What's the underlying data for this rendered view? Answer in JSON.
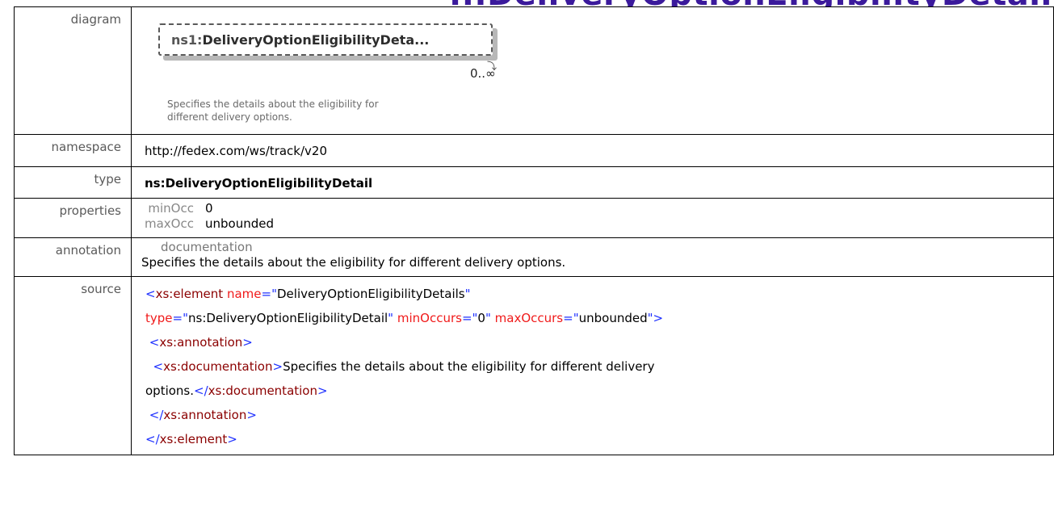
{
  "title_fragment": "...DeliveryOptionEligibilityDetails",
  "labels": {
    "diagram": "diagram",
    "namespace": "namespace",
    "type": "type",
    "properties": "properties",
    "annotation": "annotation",
    "source": "source"
  },
  "diagram": {
    "prefix": "ns1:",
    "name": "DeliveryOptionEligibilityDeta...",
    "cardinality": "0..∞",
    "documentation_line1": "Specifies the details about the eligibility for",
    "documentation_line2": "different delivery options."
  },
  "namespace": "http://fedex.com/ws/track/v20",
  "type": "ns:DeliveryOptionEligibilityDetail",
  "properties": {
    "minOcc_key": "minOcc",
    "minOcc_val": "0",
    "maxOcc_key": "maxOcc",
    "maxOcc_val": "unbounded"
  },
  "annotation": {
    "key": "documentation",
    "text": "Specifies the details about the eligibility  for different delivery options."
  },
  "source": {
    "open_bracket": "<",
    "close_bracket": ">",
    "end_open": "</",
    "quote": "\"",
    "eq": "=",
    "el_tag": "xs:element",
    "attr_name": "name",
    "name_value": "DeliveryOptionEligibilityDetails",
    "attr_type": "type",
    "type_value": "ns:DeliveryOptionEligibilityDetail",
    "attr_min": "minOccurs",
    "min_value": "0",
    "attr_max": "maxOccurs",
    "max_value": "unbounded",
    "ann_tag": "xs:annotation",
    "doc_tag": "xs:documentation",
    "doc_text_1": "Specifies the details about the eligibility for different delivery",
    "doc_text_2": "options."
  },
  "colors": {
    "tag": "#8b0000",
    "bracket": "#1f31ff",
    "attribute": "#f01a1a",
    "title": "#3b1a9c"
  }
}
